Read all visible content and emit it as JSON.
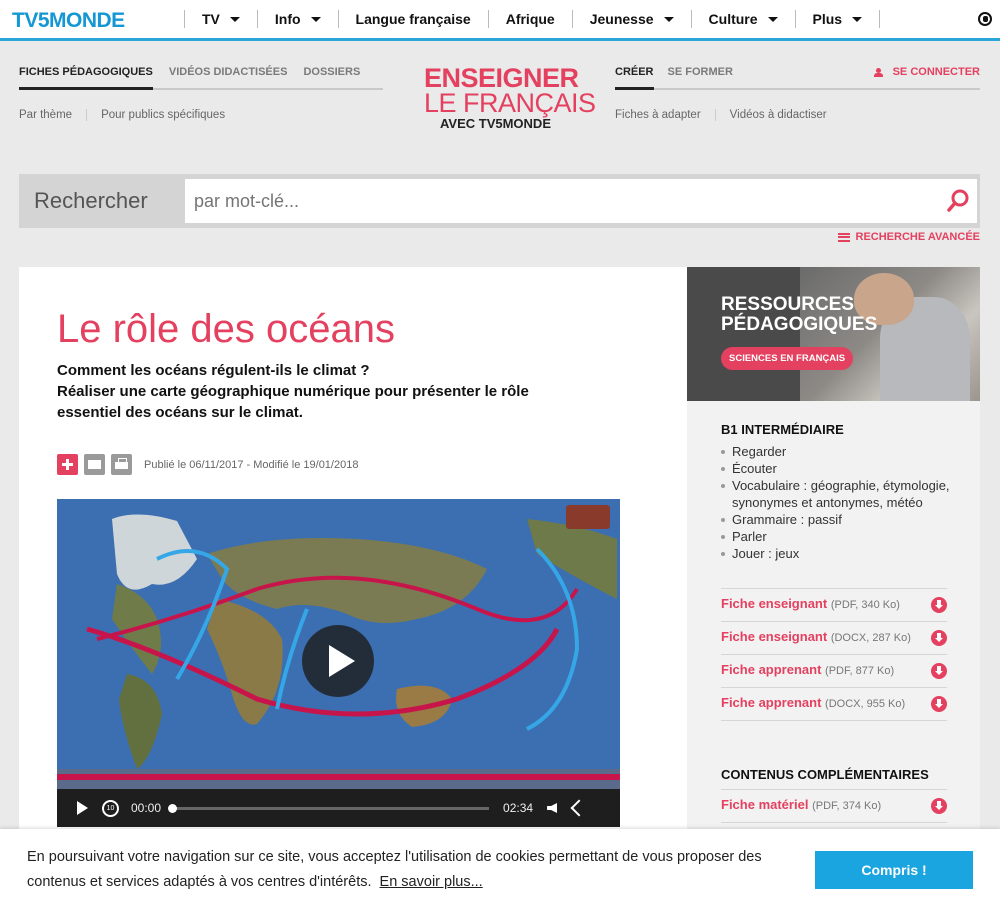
{
  "topbar": {
    "logo": "TV5MONDE",
    "nav": [
      {
        "label": "TV",
        "caret": true
      },
      {
        "label": "Info",
        "caret": true
      },
      {
        "label": "Langue française",
        "caret": false
      },
      {
        "label": "Afrique",
        "caret": false
      },
      {
        "label": "Jeunesse",
        "caret": true
      },
      {
        "label": "Culture",
        "caret": true
      },
      {
        "label": "Plus",
        "caret": true
      }
    ]
  },
  "subnav_left": {
    "tabs": [
      "FICHES PÉDAGOGIQUES",
      "VIDÉOS DIDACTISÉES",
      "DOSSIERS"
    ],
    "links": [
      "Par thème",
      "Pour publics spécifiques"
    ]
  },
  "brand": {
    "line1": "ENSEIGNER",
    "line2": "LE FRANÇAIS",
    "line3": "AVEC TV5MONDE"
  },
  "subnav_right": {
    "tabs": [
      "CRÉER",
      "SE FORMER"
    ],
    "login": "SE CONNECTER",
    "links": [
      "Fiches à adapter",
      "Vidéos à didactiser"
    ]
  },
  "search": {
    "label": "Rechercher",
    "placeholder": "par mot-clé...",
    "advanced": "RECHERCHE AVANCÉE"
  },
  "article": {
    "title": "Le rôle des océans",
    "lead1": "Comment les océans régulent-ils le climat ?",
    "lead2": "Réaliser une carte géographique numérique pour présenter le rôle essentiel des océans sur le climat.",
    "published": "Publié le 06/11/2017 - Modifié le 19/01/2018"
  },
  "video": {
    "current": "00:00",
    "duration": "02:34",
    "progress": 0,
    "replay_label": "10"
  },
  "sidebar": {
    "promo_title1": "RESSOURCES",
    "promo_title2": "PÉDAGOGIQUES",
    "promo_pill": "SCIENCES EN FRANÇAIS",
    "level": "B1 INTERMÉDIAIRE",
    "skills": [
      "Regarder",
      "Écouter",
      "Vocabulaire : géographie, étymologie, synonymes et antonymes, météo",
      "Grammaire : passif",
      "Parler",
      "Jouer : jeux"
    ],
    "files": [
      {
        "name": "Fiche enseignant",
        "meta": "(PDF, 340 Ko)"
      },
      {
        "name": "Fiche enseignant",
        "meta": "(DOCX, 287 Ko)"
      },
      {
        "name": "Fiche apprenant",
        "meta": "(PDF, 877 Ko)"
      },
      {
        "name": "Fiche apprenant",
        "meta": "(DOCX, 955 Ko)"
      }
    ],
    "complementary_title": "CONTENUS COMPLÉMENTAIRES",
    "complementary": [
      {
        "name": "Fiche matériel",
        "meta": "(PDF, 374 Ko)"
      }
    ]
  },
  "cookie": {
    "message": "En poursuivant votre navigation sur ce site, vous acceptez l'utilisation de cookies permettant de vous proposer des contenus et services adaptés à vos centres d'intérêts.",
    "more": "En savoir plus...",
    "button": "Compris !"
  },
  "colors": {
    "accent": "#e4405f",
    "brand_blue": "#1597d4",
    "cookie_button": "#1aa4e0"
  }
}
